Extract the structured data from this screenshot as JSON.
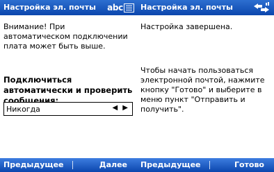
{
  "left_screen": {
    "title": "Настройка эл. почты",
    "input_mode": "abc",
    "warning": "Внимание! При автоматическом подключении плата может быть выше.",
    "question": "Подключиться автоматически и проверить сообщения:",
    "select_value": "Никогда",
    "select_arrows": "◀ ▶",
    "softkey_left": "Предыдущее",
    "softkey_right": "Далее"
  },
  "right_screen": {
    "title": "Настройка эл. почты",
    "status": "Настройка завершена.",
    "instructions": "Чтобы начать пользоваться электронной почтой, нажмите кнопку \"Готово\" и выберите в меню пункт \"Отправить и получить\".",
    "softkey_left": "Предыдущее",
    "softkey_right": "Готово"
  },
  "colors": {
    "titlebar": "#0b46ad",
    "softkeys": "#0b46ad",
    "text": "#000000",
    "background": "#ffffff"
  },
  "icons": {
    "left_titlebar": [
      "keyboard-icon"
    ],
    "right_titlebar": [
      "connectivity-arrows-icon",
      "signal-icon"
    ]
  }
}
